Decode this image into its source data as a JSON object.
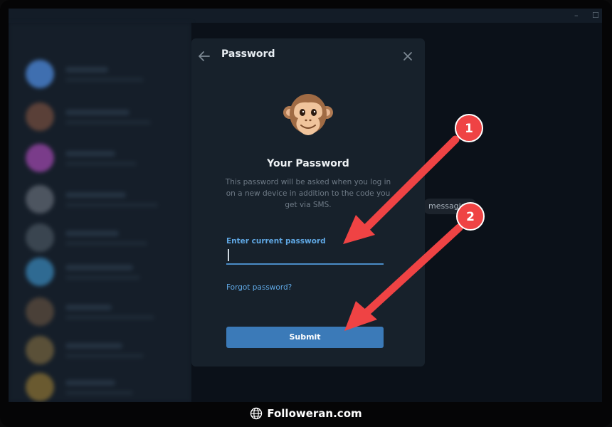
{
  "window": {
    "minimize_glyph": "–",
    "maximize_glyph": "☐"
  },
  "background": {
    "messaging_text": "messaging"
  },
  "dialog": {
    "title": "Password",
    "back_icon": "arrow-left-icon",
    "close_icon": "close-icon",
    "avatar_icon": "monkey-face-icon",
    "heading": "Your Password",
    "description": "This password will be asked when you log in on a new device in addition to the code you get via SMS.",
    "field_label": "Enter current password",
    "input_value": "",
    "forgot_link": "Forgot password?",
    "submit_label": "Submit"
  },
  "annotations": {
    "step1": "1",
    "step2": "2",
    "arrow_color": "#ef4344"
  },
  "footer": {
    "brand": "Followeran.com",
    "icon": "globe-icon"
  },
  "colors": {
    "accent": "#5fa7e3",
    "button": "#3b7ab8",
    "dialog_bg": "#17212b"
  }
}
